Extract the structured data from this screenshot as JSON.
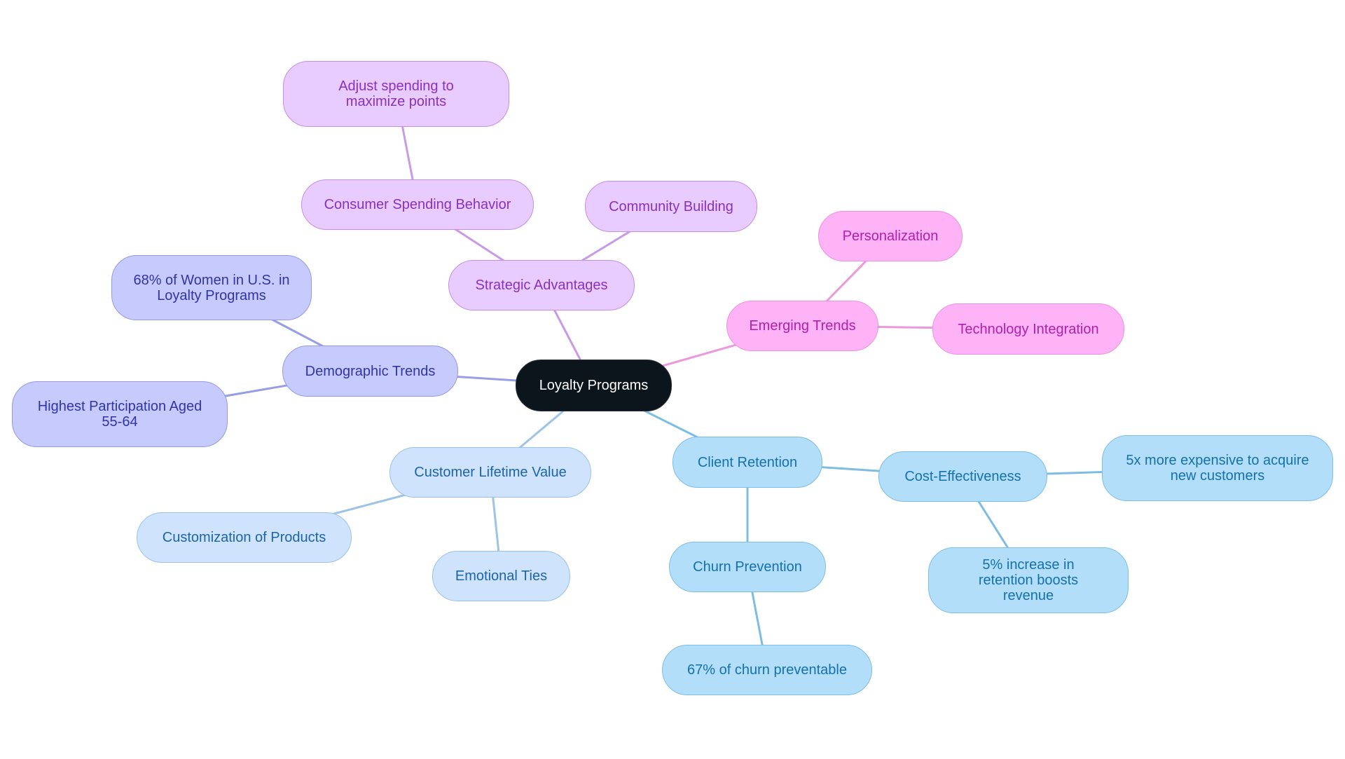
{
  "title": "Loyalty Programs",
  "colors": {
    "root": "#0c141c",
    "purple": "#e8ccff",
    "pink": "#fdb3f5",
    "indigo": "#c7cafc",
    "lightblue": "#cfe4fc",
    "skyblue": "#b3def9",
    "edge_purple": "#c99ae6",
    "edge_pink": "#eb98dc",
    "edge_indigo": "#989ee6",
    "edge_lightblue": "#9dc3e6",
    "edge_skyblue": "#7dbde3"
  },
  "nodes": {
    "root": "Loyalty Programs",
    "strategic_advantages": "Strategic Advantages",
    "consumer_spending": "Consumer Spending Behavior",
    "adjust_spending": "Adjust spending to maximize points",
    "community_building": "Community Building",
    "emerging_trends": "Emerging Trends",
    "personalization": "Personalization",
    "technology_integration": "Technology Integration",
    "demographic_trends": "Demographic Trends",
    "women_68": "68% of Women in U.S. in Loyalty Programs",
    "highest_participation": "Highest Participation Aged 55-64",
    "customer_lifetime_value": "Customer Lifetime Value",
    "customization": "Customization of Products",
    "emotional_ties": "Emotional Ties",
    "client_retention": "Client Retention",
    "churn_prevention": "Churn Prevention",
    "churn_67": "67% of churn preventable",
    "cost_effectiveness": "Cost-Effectiveness",
    "five_x_expensive": "5x more expensive to acquire new customers",
    "five_pct_increase": "5% increase in retention boosts revenue"
  },
  "edges": [
    [
      "root",
      "strategic_advantages"
    ],
    [
      "strategic_advantages",
      "consumer_spending"
    ],
    [
      "consumer_spending",
      "adjust_spending"
    ],
    [
      "strategic_advantages",
      "community_building"
    ],
    [
      "root",
      "emerging_trends"
    ],
    [
      "emerging_trends",
      "personalization"
    ],
    [
      "emerging_trends",
      "technology_integration"
    ],
    [
      "root",
      "demographic_trends"
    ],
    [
      "demographic_trends",
      "women_68"
    ],
    [
      "demographic_trends",
      "highest_participation"
    ],
    [
      "root",
      "customer_lifetime_value"
    ],
    [
      "customer_lifetime_value",
      "customization"
    ],
    [
      "customer_lifetime_value",
      "emotional_ties"
    ],
    [
      "root",
      "client_retention"
    ],
    [
      "client_retention",
      "churn_prevention"
    ],
    [
      "churn_prevention",
      "churn_67"
    ],
    [
      "client_retention",
      "cost_effectiveness"
    ],
    [
      "cost_effectiveness",
      "five_x_expensive"
    ],
    [
      "cost_effectiveness",
      "five_pct_increase"
    ]
  ]
}
